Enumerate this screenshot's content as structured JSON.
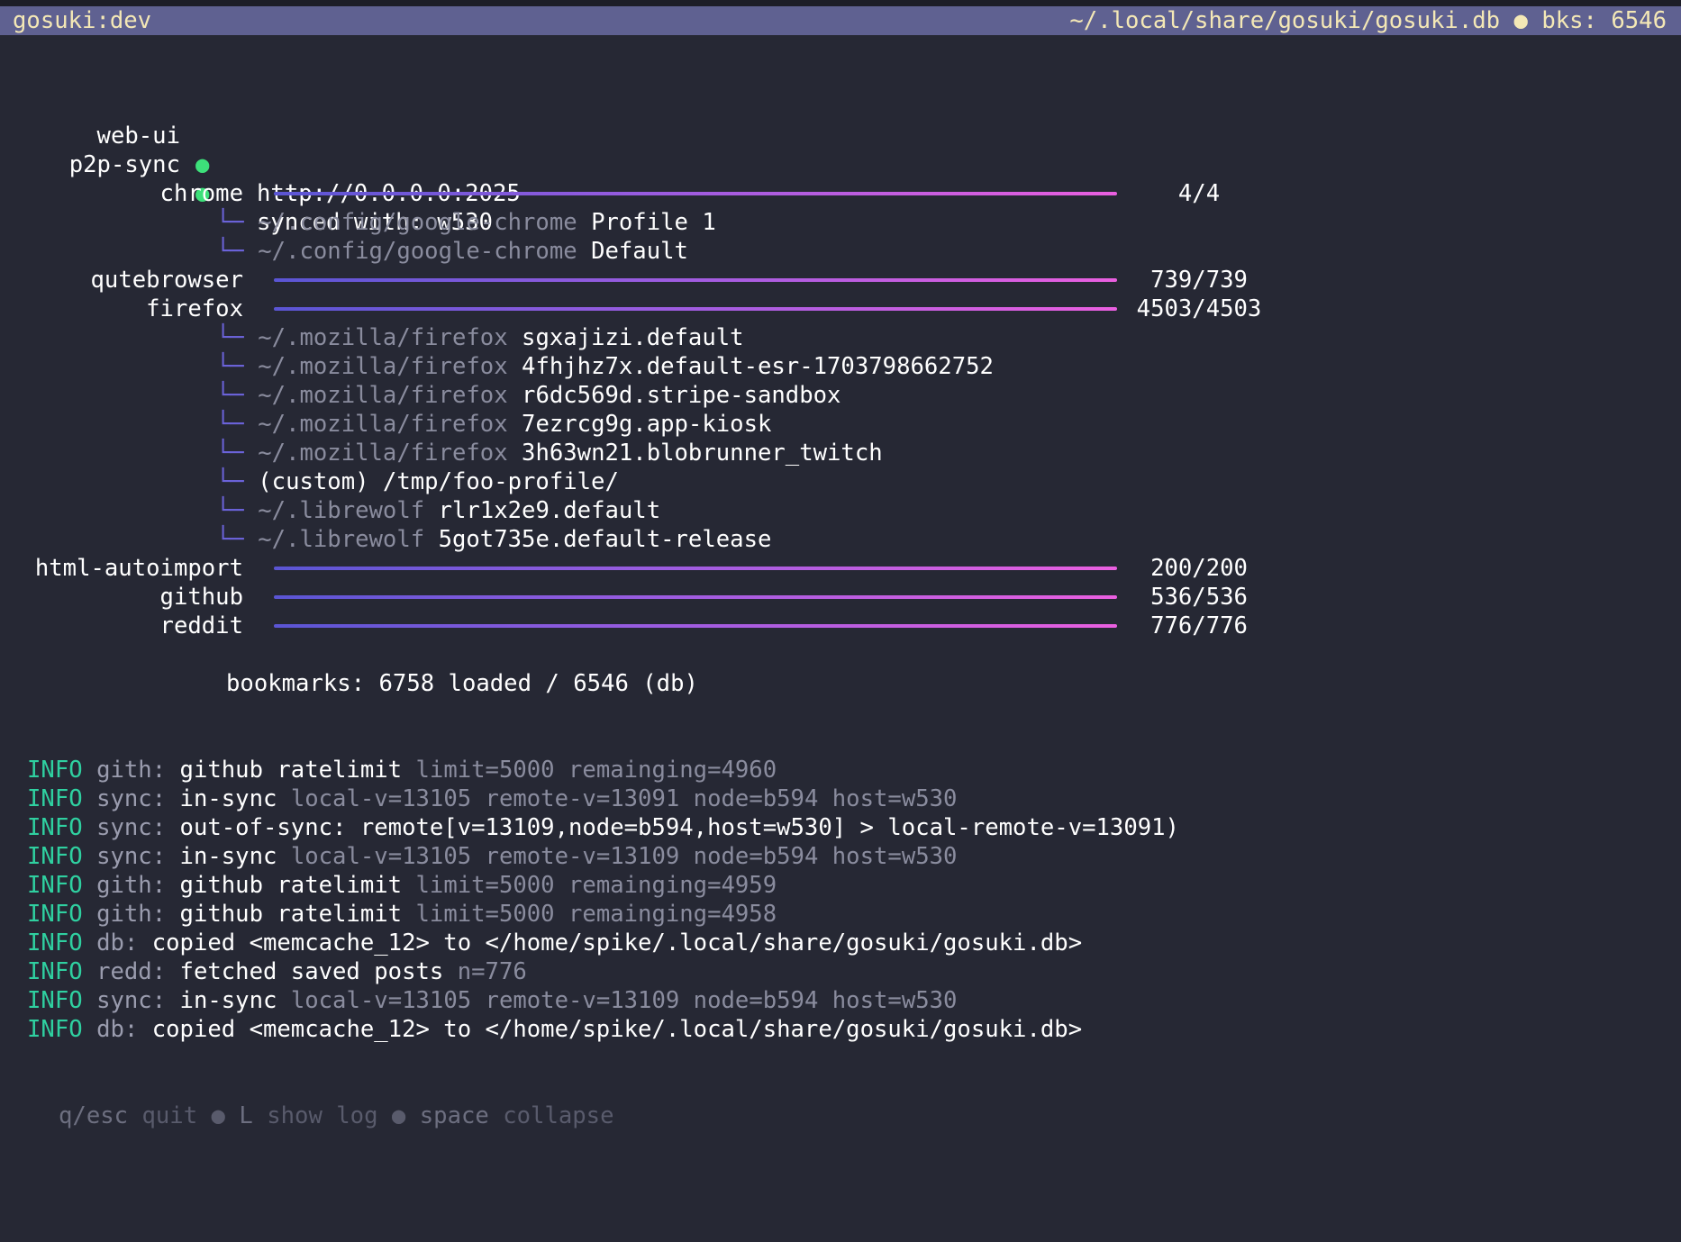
{
  "statusbar": {
    "app": "gosuki:dev",
    "db_path": "~/.local/share/gosuki/gosuki.db",
    "separator_dot": "●",
    "bookmarks": "bks: 6546"
  },
  "services": [
    {
      "name": "web-ui",
      "status": "●",
      "value": "http://0.0.0.0:2025"
    },
    {
      "name": "p2p-sync",
      "status": "●",
      "value": "synced with: w530"
    }
  ],
  "tree_glyph": "└─",
  "modules": {
    "chrome": {
      "name": "chrome",
      "count": "4/4",
      "progress": 1.0,
      "profiles": [
        {
          "path": "~/.config/google-chrome",
          "name": "Profile 1"
        },
        {
          "path": "~/.config/google-chrome",
          "name": "Default"
        }
      ]
    },
    "qutebrowser": {
      "name": "qutebrowser",
      "count": "739/739",
      "progress": 1.0
    },
    "firefox": {
      "name": "firefox",
      "count": "4503/4503",
      "progress": 1.0,
      "profiles": [
        {
          "path": "~/.mozilla/firefox",
          "name": "sgxajizi.default"
        },
        {
          "path": "~/.mozilla/firefox",
          "name": "4fhjhz7x.default-esr-1703798662752"
        },
        {
          "path": "~/.mozilla/firefox",
          "name": "r6dc569d.stripe-sandbox"
        },
        {
          "path": "~/.mozilla/firefox",
          "name": "7ezrcg9g.app-kiosk"
        },
        {
          "path": "~/.mozilla/firefox",
          "name": "3h63wn21.blobrunner_twitch"
        },
        {
          "path": "",
          "name": "(custom) /tmp/foo-profile/"
        },
        {
          "path": "~/.librewolf",
          "name": "rlr1x2e9.default"
        },
        {
          "path": "~/.librewolf",
          "name": "5got735e.default-release"
        }
      ]
    },
    "html_autoimport": {
      "name": "html-autoimport",
      "count": "200/200",
      "progress": 1.0
    },
    "github": {
      "name": "github",
      "count": "536/536",
      "progress": 1.0
    },
    "reddit": {
      "name": "reddit",
      "count": "776/776",
      "progress": 1.0
    }
  },
  "summary": "bookmarks: 6758 loaded / 6546 (db)",
  "log": [
    {
      "level": "INFO",
      "src": "gith:",
      "msg": "github ratelimit",
      "kv": "limit=5000 remainging=4960"
    },
    {
      "level": "INFO",
      "src": "sync:",
      "msg": "in-sync",
      "kv": "local-v=13105 remote-v=13091 node=b594 host=w530"
    },
    {
      "level": "INFO",
      "src": "sync:",
      "msg": "out-of-sync: remote[v=13109,node=b594,host=w530] > local-remote-v=13091)",
      "kv": ""
    },
    {
      "level": "INFO",
      "src": "sync:",
      "msg": "in-sync",
      "kv": "local-v=13105 remote-v=13109 node=b594 host=w530"
    },
    {
      "level": "INFO",
      "src": "gith:",
      "msg": "github ratelimit",
      "kv": "limit=5000 remainging=4959"
    },
    {
      "level": "INFO",
      "src": "gith:",
      "msg": "github ratelimit",
      "kv": "limit=5000 remainging=4958"
    },
    {
      "level": "INFO",
      "src": "db:",
      "msg": "copied <memcache_12> to </home/spike/.local/share/gosuki/gosuki.db>",
      "kv": ""
    },
    {
      "level": "INFO",
      "src": "redd:",
      "msg": "fetched saved posts",
      "kv": "n=776"
    },
    {
      "level": "INFO",
      "src": "sync:",
      "msg": "in-sync",
      "kv": "local-v=13105 remote-v=13109 node=b594 host=w530"
    },
    {
      "level": "INFO",
      "src": "db:",
      "msg": "copied <memcache_12> to </home/spike/.local/share/gosuki/gosuki.db>",
      "kv": ""
    }
  ],
  "help": [
    {
      "key": "q/esc",
      "action": "quit"
    },
    {
      "key": "L",
      "action": "show log"
    },
    {
      "key": "space",
      "action": "collapse"
    }
  ],
  "help_separator": "●"
}
